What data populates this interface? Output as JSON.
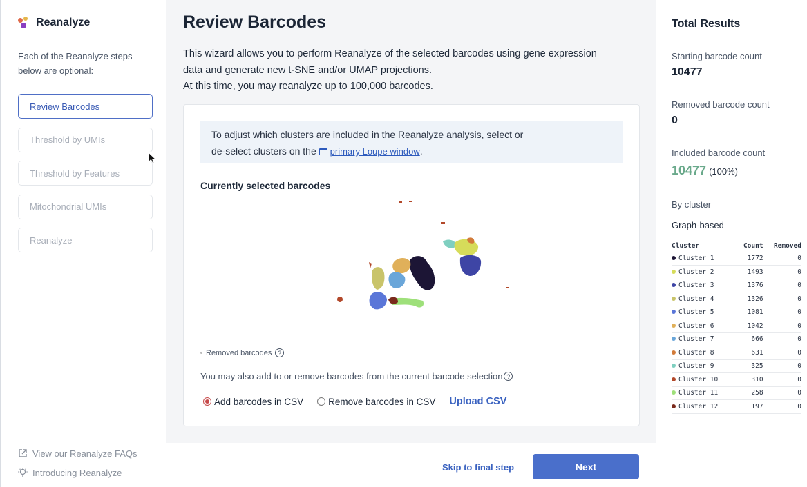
{
  "app": {
    "title": "Reanalyze"
  },
  "sidebar": {
    "intro": "Each of the Reanalyze steps below are optional:",
    "steps": [
      {
        "label": "Review Barcodes",
        "active": true
      },
      {
        "label": "Threshold by UMIs",
        "active": false
      },
      {
        "label": "Threshold by Features",
        "active": false
      },
      {
        "label": "Mitochondrial UMIs",
        "active": false
      },
      {
        "label": "Reanalyze",
        "active": false
      }
    ],
    "links": [
      {
        "label": "View our Reanalyze FAQs",
        "icon": "external-link-icon"
      },
      {
        "label": "Introducing Reanalyze",
        "icon": "lightbulb-icon"
      }
    ]
  },
  "main": {
    "title": "Review Barcodes",
    "description_line1": "This wizard allows you to perform Reanalyze of the selected barcodes using gene expression",
    "description_line2": "data and generate new t-SNE and/or UMAP projections.",
    "description_line3": "At this time, you may reanalyze up to 100,000 barcodes.",
    "info_line1": "To adjust which clusters are included in the Reanalyze analysis, select or",
    "info_line2_prefix": "de-select clusters on the",
    "info_link": "primary Loupe window",
    "info_suffix": ".",
    "plot_title": "Currently selected barcodes",
    "removed_note": "Removed barcodes",
    "add_note": "You may also add to or remove barcodes from the current barcode selection",
    "radio_add": "Add barcodes in CSV",
    "radio_remove": "Remove barcodes in CSV",
    "upload": "Upload CSV",
    "selected_radio": "add"
  },
  "footer": {
    "skip": "Skip to final step",
    "next": "Next"
  },
  "results": {
    "title": "Total Results",
    "starting_label": "Starting barcode count",
    "starting_value": "10477",
    "removed_label": "Removed barcode count",
    "removed_value": "0",
    "included_label": "Included barcode count",
    "included_value": "10477",
    "included_pct": "(100%)",
    "by_cluster": "By cluster",
    "graph_based": "Graph-based",
    "headers": {
      "cluster": "Cluster",
      "count": "Count",
      "removed": "Removed"
    },
    "clusters": [
      {
        "name": "Cluster 1",
        "count": "1772",
        "removed": "0",
        "color": "#1c1535"
      },
      {
        "name": "Cluster 2",
        "count": "1493",
        "removed": "0",
        "color": "#d6dc5a"
      },
      {
        "name": "Cluster 3",
        "count": "1376",
        "removed": "0",
        "color": "#3e45a5"
      },
      {
        "name": "Cluster 4",
        "count": "1326",
        "removed": "0",
        "color": "#c9c46a"
      },
      {
        "name": "Cluster 5",
        "count": "1081",
        "removed": "0",
        "color": "#5a76d8"
      },
      {
        "name": "Cluster 6",
        "count": "1042",
        "removed": "0",
        "color": "#e0b05a"
      },
      {
        "name": "Cluster 7",
        "count": "666",
        "removed": "0",
        "color": "#6aa6d9"
      },
      {
        "name": "Cluster 8",
        "count": "631",
        "removed": "0",
        "color": "#d27b3a"
      },
      {
        "name": "Cluster 9",
        "count": "325",
        "removed": "0",
        "color": "#7fcfc0"
      },
      {
        "name": "Cluster 10",
        "count": "310",
        "removed": "0",
        "color": "#b2482a"
      },
      {
        "name": "Cluster 11",
        "count": "258",
        "removed": "0",
        "color": "#9ee07a"
      },
      {
        "name": "Cluster 12",
        "count": "197",
        "removed": "0",
        "color": "#7a2a1c"
      }
    ]
  },
  "colors": {
    "accent": "#4a6fcb",
    "included_green": "#6aa98b",
    "radio_red": "#c64a4a"
  }
}
